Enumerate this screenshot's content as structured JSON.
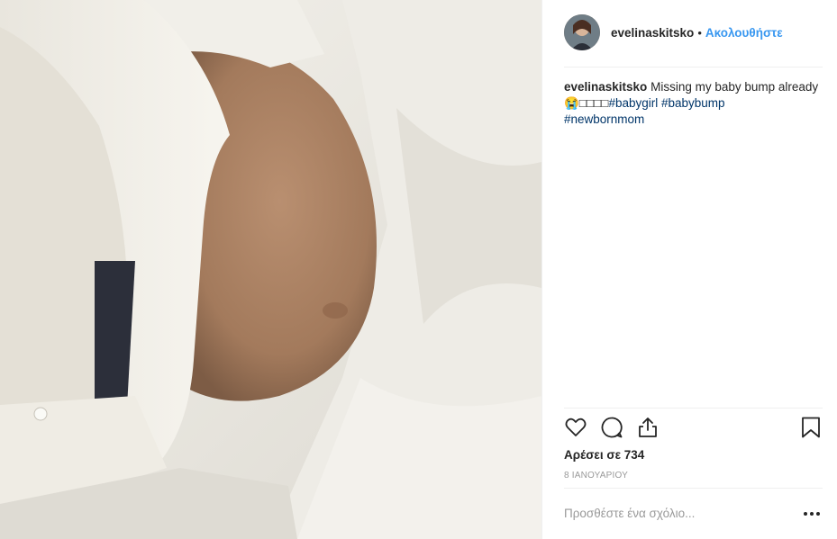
{
  "post": {
    "username": "evelinaskitsko",
    "separator": "•",
    "follow_label": "Ακολουθήστε",
    "caption_username": "evelinaskitsko",
    "caption_text": "Missing my baby bump already",
    "caption_emoji": "😭□□□□",
    "hashtags": [
      "#babygirl",
      "#babybump",
      "#newbornmom"
    ],
    "likes_text": "Αρέσει σε 734",
    "date_text": "8 ΙΑΝΟΥΑΡΙΟΥ",
    "comment_placeholder": "Προσθέστε ένα σχόλιο..."
  },
  "icons": {
    "like": "heart-icon",
    "comment": "comment-icon",
    "share": "share-icon",
    "save": "bookmark-icon",
    "more": "more-dots-icon"
  },
  "colors": {
    "follow": "#3897f0",
    "hashtag": "#003569",
    "muted": "#999999",
    "text": "#262626"
  }
}
